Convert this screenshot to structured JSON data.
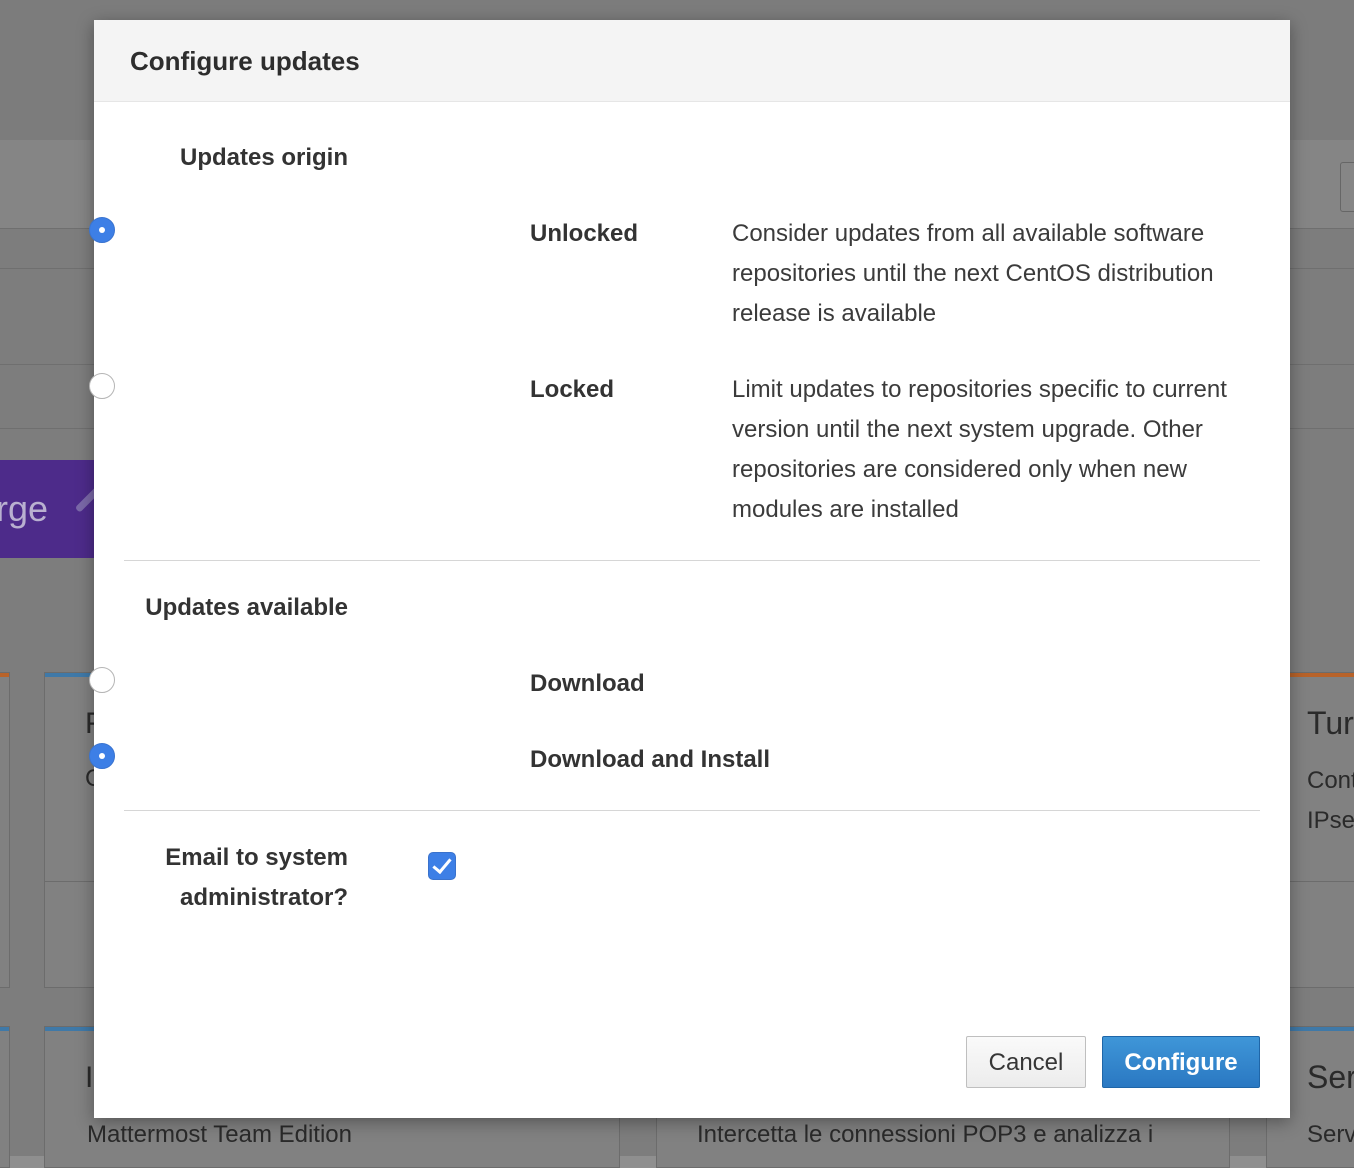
{
  "modal": {
    "title": "Configure updates",
    "updates_origin": {
      "label": "Updates origin",
      "options": [
        {
          "label": "Unlocked",
          "description": "Consider updates from all available software repositories until the next CentOS distribution release is available",
          "selected": true
        },
        {
          "label": "Locked",
          "description": "Limit updates to repositories specific to current version until the next system upgrade. Other repositories are considered only when new modules are installed",
          "selected": false
        }
      ]
    },
    "updates_available": {
      "label": "Updates available",
      "options": [
        {
          "label": "Download",
          "selected": false
        },
        {
          "label": "Download and Install",
          "selected": true
        }
      ]
    },
    "email": {
      "label_line1": "Email to system",
      "label_line2": "administrator?",
      "checked": true
    },
    "buttons": {
      "cancel": "Cancel",
      "configure": "Configure"
    }
  },
  "background": {
    "banner_fragment": "rge",
    "cards": {
      "left_initial": "F",
      "left_initial_2": "C",
      "right_title_fragment": "Tur",
      "right_line1": "Cont",
      "right_line2": "IPse",
      "bottom_left_initial": "I",
      "bottom_left_text": "Mattermost Team Edition",
      "bottom_mid_text": "Intercetta le connessioni POP3 e analizza i",
      "bottom_right_title": "Ser",
      "bottom_right_text": "Serv"
    }
  },
  "colors": {
    "accent_blue": "#3d7fe6",
    "primary_button": "#2a78c2",
    "banner_purple": "#4d2b8a"
  }
}
